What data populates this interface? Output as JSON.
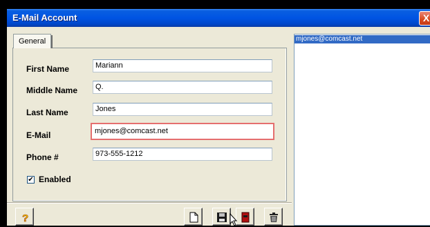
{
  "window": {
    "title": "E-Mail Account",
    "close_label": "X"
  },
  "tabs": [
    {
      "label": "General"
    }
  ],
  "form": {
    "first_name": {
      "label": "First Name",
      "value": "Mariann"
    },
    "middle_name": {
      "label": "Middle Name",
      "value": "Q."
    },
    "last_name": {
      "label": "Last Name",
      "value": "Jones"
    },
    "email": {
      "label": "E-Mail",
      "value": "mjones@comcast.net"
    },
    "phone": {
      "label": "Phone #",
      "value": "973-555-1212"
    },
    "enabled": {
      "label": "Enabled",
      "checked": true,
      "mark": "✔"
    }
  },
  "toolbar": {
    "help_icon": "question-mark-icon",
    "new_icon": "new-document-icon",
    "save_icon": "floppy-disk-icon",
    "close_icon": "red-book-icon",
    "delete_icon": "trash-can-icon"
  },
  "account_list": {
    "items": [
      "mjones@comcast.net"
    ]
  },
  "colors": {
    "titlebar": "#0054e3",
    "highlight_border": "#e56e6e",
    "selection": "#316ac5",
    "window_bg": "#ece9d8"
  }
}
